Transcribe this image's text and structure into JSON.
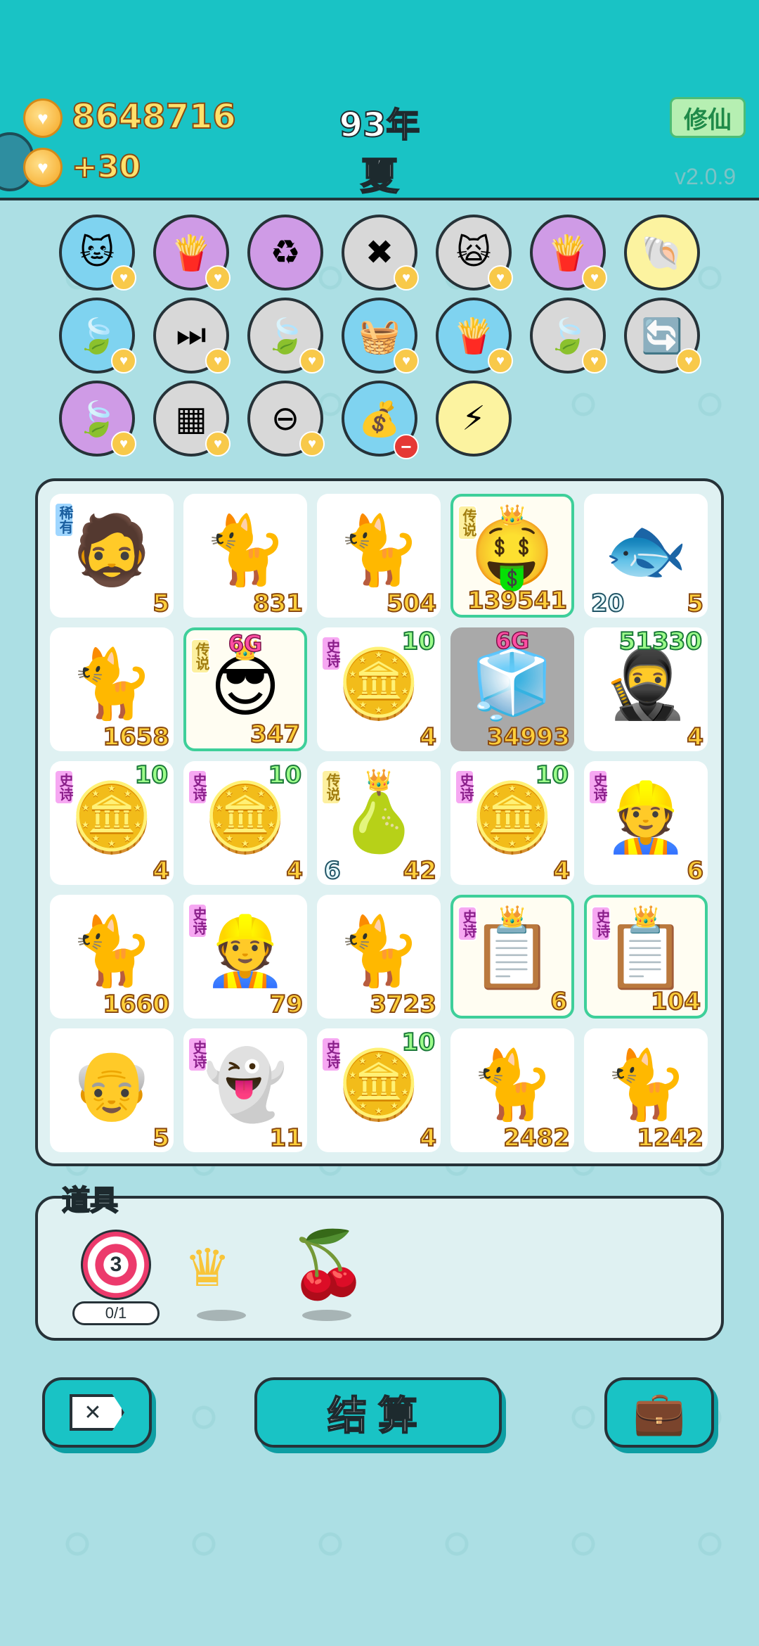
{
  "header": {
    "coins": "8648716",
    "coin_rate": "+30",
    "year": "93年",
    "season": "夏",
    "xiuxian_button": "修仙",
    "version": "v2.0.9"
  },
  "skills": [
    {
      "icon": "cat-icon",
      "glyph": "🐱",
      "bg": "#7fd3f0"
    },
    {
      "icon": "fries-icon",
      "glyph": "🍟",
      "bg": "#cf9be6"
    },
    {
      "icon": "recycle-icon",
      "glyph": "♻",
      "bg": "#cf9be6"
    },
    {
      "icon": "delete-tag-icon",
      "glyph": "✖",
      "bg": "#d8d8d8"
    },
    {
      "icon": "cat-eyes-icon",
      "glyph": "🙀",
      "bg": "#d8d8d8"
    },
    {
      "icon": "fries-icon",
      "glyph": "🍟",
      "bg": "#cf9be6"
    },
    {
      "icon": "shell-icon",
      "glyph": "🐚",
      "bg": "#fcf3a0"
    },
    {
      "icon": "leaf-icon",
      "glyph": "🍃",
      "bg": "#7fd3f0"
    },
    {
      "icon": "skip-icon",
      "glyph": "⏭",
      "bg": "#d8d8d8"
    },
    {
      "icon": "leaf-icon",
      "glyph": "🍃",
      "bg": "#d8d8d8"
    },
    {
      "icon": "fruit-basket-icon",
      "glyph": "🧺",
      "bg": "#7fd3f0"
    },
    {
      "icon": "fries-icon",
      "glyph": "🍟",
      "bg": "#7fd3f0"
    },
    {
      "icon": "leaf-icon",
      "glyph": "🍃",
      "bg": "#d8d8d8"
    },
    {
      "icon": "refresh-icon",
      "glyph": "🔄",
      "bg": "#d8d8d8"
    },
    {
      "icon": "leaf-icon",
      "glyph": "🍃",
      "bg": "#cf9be6"
    },
    {
      "icon": "sugar-cubes-icon",
      "glyph": "▦",
      "bg": "#d8d8d8"
    },
    {
      "icon": "no-entry-icon",
      "glyph": "⊖",
      "bg": "#d8d8d8"
    },
    {
      "icon": "bag-icon",
      "glyph": "💰",
      "bg": "#7fd3f0"
    },
    {
      "icon": "lightning-icon",
      "glyph": "⚡",
      "bg": "#fcf3a0"
    }
  ],
  "board": [
    [
      {
        "name": "bandit",
        "glyph": "🧔",
        "tag": "稀有",
        "tag_type": "xiyou",
        "value": "5"
      },
      {
        "name": "cat",
        "glyph": "🐈",
        "value": "831"
      },
      {
        "name": "cat",
        "glyph": "🐈",
        "value": "504"
      },
      {
        "name": "king-boss",
        "glyph": "🤑",
        "tag": "传说",
        "tag_type": "chuanshuo",
        "crown": true,
        "glow": true,
        "value": "139541"
      },
      {
        "name": "fish",
        "glyph": "🐟",
        "value": "5",
        "left_value": "20"
      }
    ],
    [
      {
        "name": "cat",
        "glyph": "🐈",
        "value": "1658"
      },
      {
        "name": "cool-king",
        "glyph": "😎",
        "tag": "传说",
        "tag_type": "chuanshuo",
        "crown": true,
        "glow": true,
        "label6g": "6G",
        "value": "347"
      },
      {
        "name": "coin-cut",
        "glyph": "🪙",
        "tag": "史诗",
        "tag_type": "shishi",
        "value": "4",
        "top_value": "10"
      },
      {
        "name": "fridge",
        "glyph": "🧊",
        "grey": true,
        "label6g": "6G",
        "value": "34993"
      },
      {
        "name": "thief",
        "glyph": "🥷",
        "value": "4",
        "top_value": "51330"
      }
    ],
    [
      {
        "name": "coin-cut",
        "glyph": "🪙",
        "tag": "史诗",
        "tag_type": "shishi",
        "value": "4",
        "top_value": "10"
      },
      {
        "name": "coin-cut",
        "glyph": "🪙",
        "tag": "史诗",
        "tag_type": "shishi",
        "value": "4",
        "top_value": "10"
      },
      {
        "name": "pear-king",
        "glyph": "🍐",
        "tag": "传说",
        "tag_type": "chuanshuo",
        "crown": true,
        "value": "42",
        "left_value": "6"
      },
      {
        "name": "coin-cut",
        "glyph": "🪙",
        "tag": "史诗",
        "tag_type": "shishi",
        "value": "4",
        "top_value": "10"
      },
      {
        "name": "grumpy-worker",
        "glyph": "👷",
        "tag": "史诗",
        "tag_type": "shishi",
        "value": "6"
      }
    ],
    [
      {
        "name": "cat",
        "glyph": "🐈",
        "value": "1660"
      },
      {
        "name": "grumpy-worker",
        "glyph": "👷",
        "tag": "史诗",
        "tag_type": "shishi",
        "value": "79"
      },
      {
        "name": "cat",
        "glyph": "🐈",
        "value": "3723"
      },
      {
        "name": "ctrl-cv",
        "glyph": "📋",
        "tag": "史诗",
        "tag_type": "shishi",
        "crown": true,
        "glow": true,
        "value": "6"
      },
      {
        "name": "ctrl-cv",
        "glyph": "📋",
        "tag": "史诗",
        "tag_type": "shishi",
        "crown": true,
        "glow": true,
        "value": "104"
      }
    ],
    [
      {
        "name": "old-man",
        "glyph": "👴",
        "value": "5"
      },
      {
        "name": "ghost",
        "glyph": "👻",
        "tag": "史诗",
        "tag_type": "shishi",
        "value": "11"
      },
      {
        "name": "coin-cut",
        "glyph": "🪙",
        "tag": "史诗",
        "tag_type": "shishi",
        "value": "4",
        "top_value": "10"
      },
      {
        "name": "cat",
        "glyph": "🐈",
        "value": "2482"
      },
      {
        "name": "cat",
        "glyph": "🐈",
        "value": "1242"
      }
    ]
  ],
  "items": {
    "label": "道具",
    "target_number": "3",
    "target_counter": "0/1"
  },
  "buttons": {
    "settle_label": "结算"
  },
  "colors": {
    "header_bg": "#19c3c5",
    "board_bg": "#dff1f2",
    "outline": "#263238"
  }
}
